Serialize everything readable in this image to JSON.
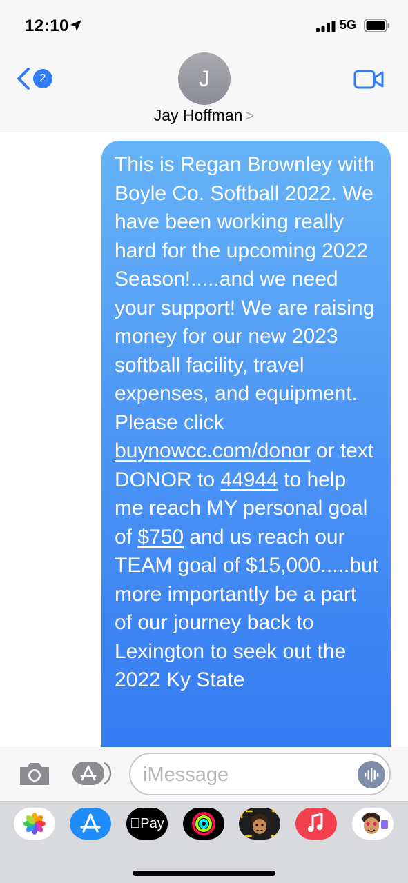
{
  "status_bar": {
    "time": "12:10",
    "network": "5G"
  },
  "header": {
    "back_badge": "2",
    "avatar_initial": "J",
    "contact_name": "Jay Hoffman",
    "chevron": ">"
  },
  "message": {
    "segments": [
      "This is Regan Brownley with Boyle Co. Softball 2022.  We have been working really hard for the upcoming 2022 Season!.....and we need your support!  We are raising money for our new 2023 softball facility, travel expenses, and equipment. Please click ",
      "buynowcc.com/donor",
      " or text DONOR to ",
      "44944",
      " to help me reach MY personal goal of ",
      "$750",
      " and us reach our TEAM goal of $15,000.....but more importantly be a part of our journey back to Lexington to seek out the 2022 Ky State"
    ]
  },
  "input_bar": {
    "placeholder": "iMessage"
  },
  "app_drawer": {
    "apps": [
      {
        "name": "photos-app-icon",
        "color": "#ffffff"
      },
      {
        "name": "app-store-icon",
        "color": "#1d8cf8"
      },
      {
        "name": "apple-pay-icon",
        "label": "Pay",
        "color": "#000000"
      },
      {
        "name": "activity-icon",
        "color": "#000000"
      },
      {
        "name": "memoji-icon",
        "color": "#1e1e1e"
      },
      {
        "name": "music-icon",
        "color": "#f2404e"
      },
      {
        "name": "memoji-stickers-icon",
        "color": "#ffffff"
      }
    ]
  }
}
